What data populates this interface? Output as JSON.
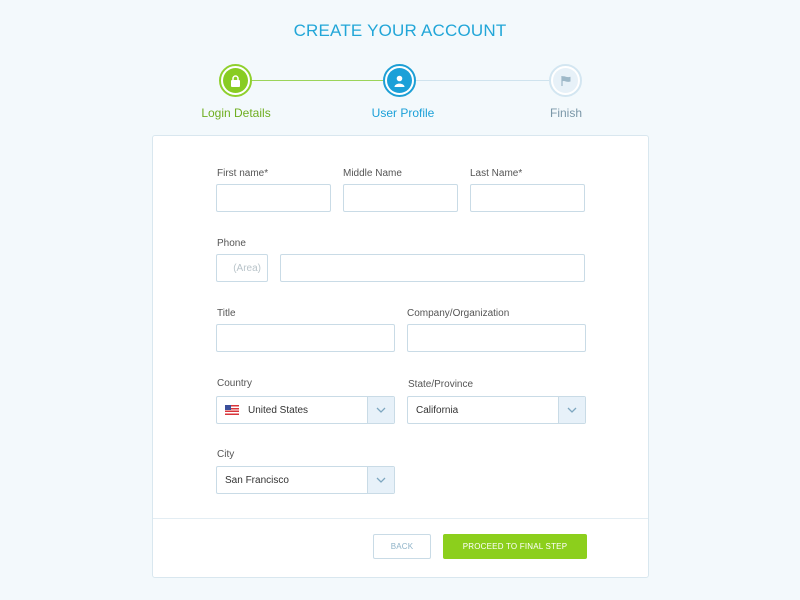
{
  "title": "CREATE YOUR ACCOUNT",
  "steps": [
    {
      "label": "Login Details",
      "icon": "lock-icon",
      "state": "complete"
    },
    {
      "label": "User Profile",
      "icon": "user-icon",
      "state": "active"
    },
    {
      "label": "Finish",
      "icon": "flag-icon",
      "state": "pending"
    }
  ],
  "form": {
    "first_name": {
      "label": "First name*",
      "value": ""
    },
    "middle_name": {
      "label": "Middle Name",
      "value": ""
    },
    "last_name": {
      "label": "Last Name*",
      "value": ""
    },
    "phone": {
      "label": "Phone",
      "area_placeholder": "(Area)",
      "value": ""
    },
    "title": {
      "label": "Title",
      "value": ""
    },
    "company": {
      "label": "Company/Organization",
      "value": ""
    },
    "country": {
      "label": "Country",
      "value": "United States",
      "flag": "us-flag-icon"
    },
    "state": {
      "label": "State/Province",
      "value": "California"
    },
    "city": {
      "label": "City",
      "value": "San Francisco"
    }
  },
  "buttons": {
    "back": "BACK",
    "proceed": "PROCEED TO FINAL STEP"
  },
  "colors": {
    "accent_blue": "#1ba0d8",
    "accent_green": "#88cc22",
    "background": "#f3f9fc"
  }
}
